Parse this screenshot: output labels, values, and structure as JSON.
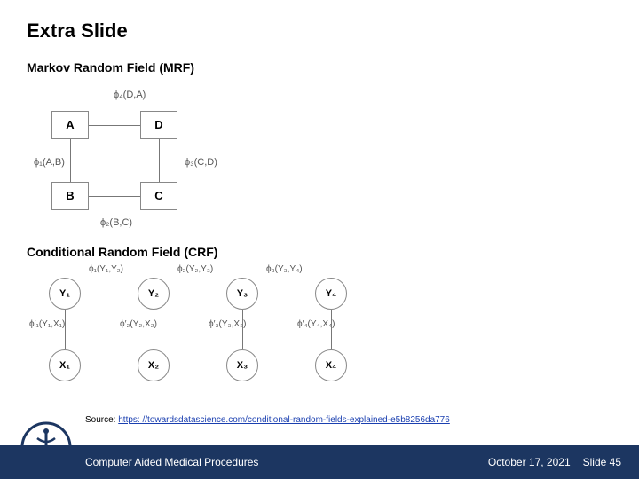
{
  "title": "Extra Slide",
  "section1": "Markov Random Field (MRF)",
  "section2": "Conditional Random Field (CRF)",
  "mrf": {
    "nodes": {
      "A": "A",
      "B": "B",
      "C": "C",
      "D": "D"
    },
    "labels": {
      "phi4": "ϕ₄(D,A)",
      "phi1": "ϕ₁(A,B)",
      "phi3": "ϕ₃(C,D)",
      "phi2": "ϕ₂(B,C)"
    }
  },
  "crf": {
    "ynodes": [
      "Y₁",
      "Y₂",
      "Y₃",
      "Y₄"
    ],
    "xnodes": [
      "X₁",
      "X₂",
      "X₃",
      "X₄"
    ],
    "top_labels": [
      "ϕ₁(Y₁,Y₂)",
      "ϕ₂(Y₂,Y₃)",
      "ϕ₃(Y₃,Y₄)"
    ],
    "mid_labels": [
      "ϕ′₁(Y₁,X₁)",
      "ϕ′₂(Y₂,X₂)",
      "ϕ′₃(Y₃,X₃)",
      "ϕ′₄(Y₄,X₄)"
    ]
  },
  "source_label": "Source: ",
  "source_url_text": "https: //towardsdatascience.com/conditional-random-fields-explained-e5b8256da776",
  "footer": {
    "left": "Computer Aided Medical Procedures",
    "date": "October 17, 2021",
    "slide": "Slide 45"
  }
}
